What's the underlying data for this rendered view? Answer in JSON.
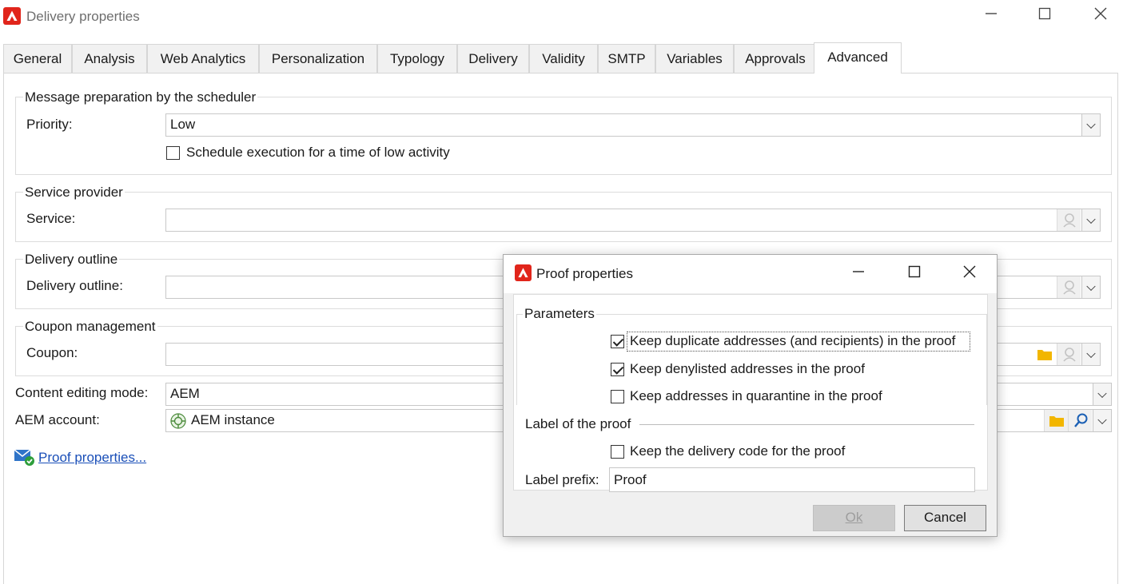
{
  "window": {
    "title": "Delivery properties",
    "minimize_glyph": "—",
    "maximize_glyph": "☐",
    "close_glyph": "✕",
    "brand_color": "#e1251b"
  },
  "tabs": [
    {
      "label": "General"
    },
    {
      "label": "Analysis"
    },
    {
      "label": "Web Analytics"
    },
    {
      "label": "Personalization"
    },
    {
      "label": "Typology"
    },
    {
      "label": "Delivery"
    },
    {
      "label": "Validity"
    },
    {
      "label": "SMTP"
    },
    {
      "label": "Variables"
    },
    {
      "label": "Approvals"
    },
    {
      "label": "Advanced",
      "active": true
    }
  ],
  "message_prep": {
    "legend": "Message preparation by the scheduler",
    "priority_label": "Priority:",
    "priority_value": "Low",
    "schedule_checkbox_label": "Schedule execution for a time of low activity",
    "schedule_checked": false
  },
  "service_provider": {
    "legend": "Service provider",
    "service_label": "Service:",
    "service_value": ""
  },
  "delivery_outline": {
    "legend": "Delivery outline",
    "outline_label": "Delivery outline:",
    "outline_value": ""
  },
  "coupon_management": {
    "legend": "Coupon management",
    "coupon_label": "Coupon:",
    "coupon_value": ""
  },
  "content_editing": {
    "mode_label": "Content editing mode:",
    "mode_value": "AEM",
    "account_label": "AEM account:",
    "account_value": "AEM instance"
  },
  "proof_link": {
    "label": "Proof properties..."
  },
  "dialog": {
    "title": "Proof properties",
    "parameters_legend": "Parameters",
    "options": [
      {
        "label": "Keep duplicate addresses (and recipients) in the proof",
        "checked": true
      },
      {
        "label": "Keep denylisted addresses in the proof",
        "checked": true
      },
      {
        "label": "Keep addresses in quarantine in the proof",
        "checked": false
      }
    ],
    "label_section": "Label of the proof",
    "keep_code_label": "Keep the delivery code for the proof",
    "keep_code_checked": false,
    "prefix_label": "Label prefix:",
    "prefix_value": "Proof",
    "ok_label": "Ok",
    "cancel_label": "Cancel"
  }
}
